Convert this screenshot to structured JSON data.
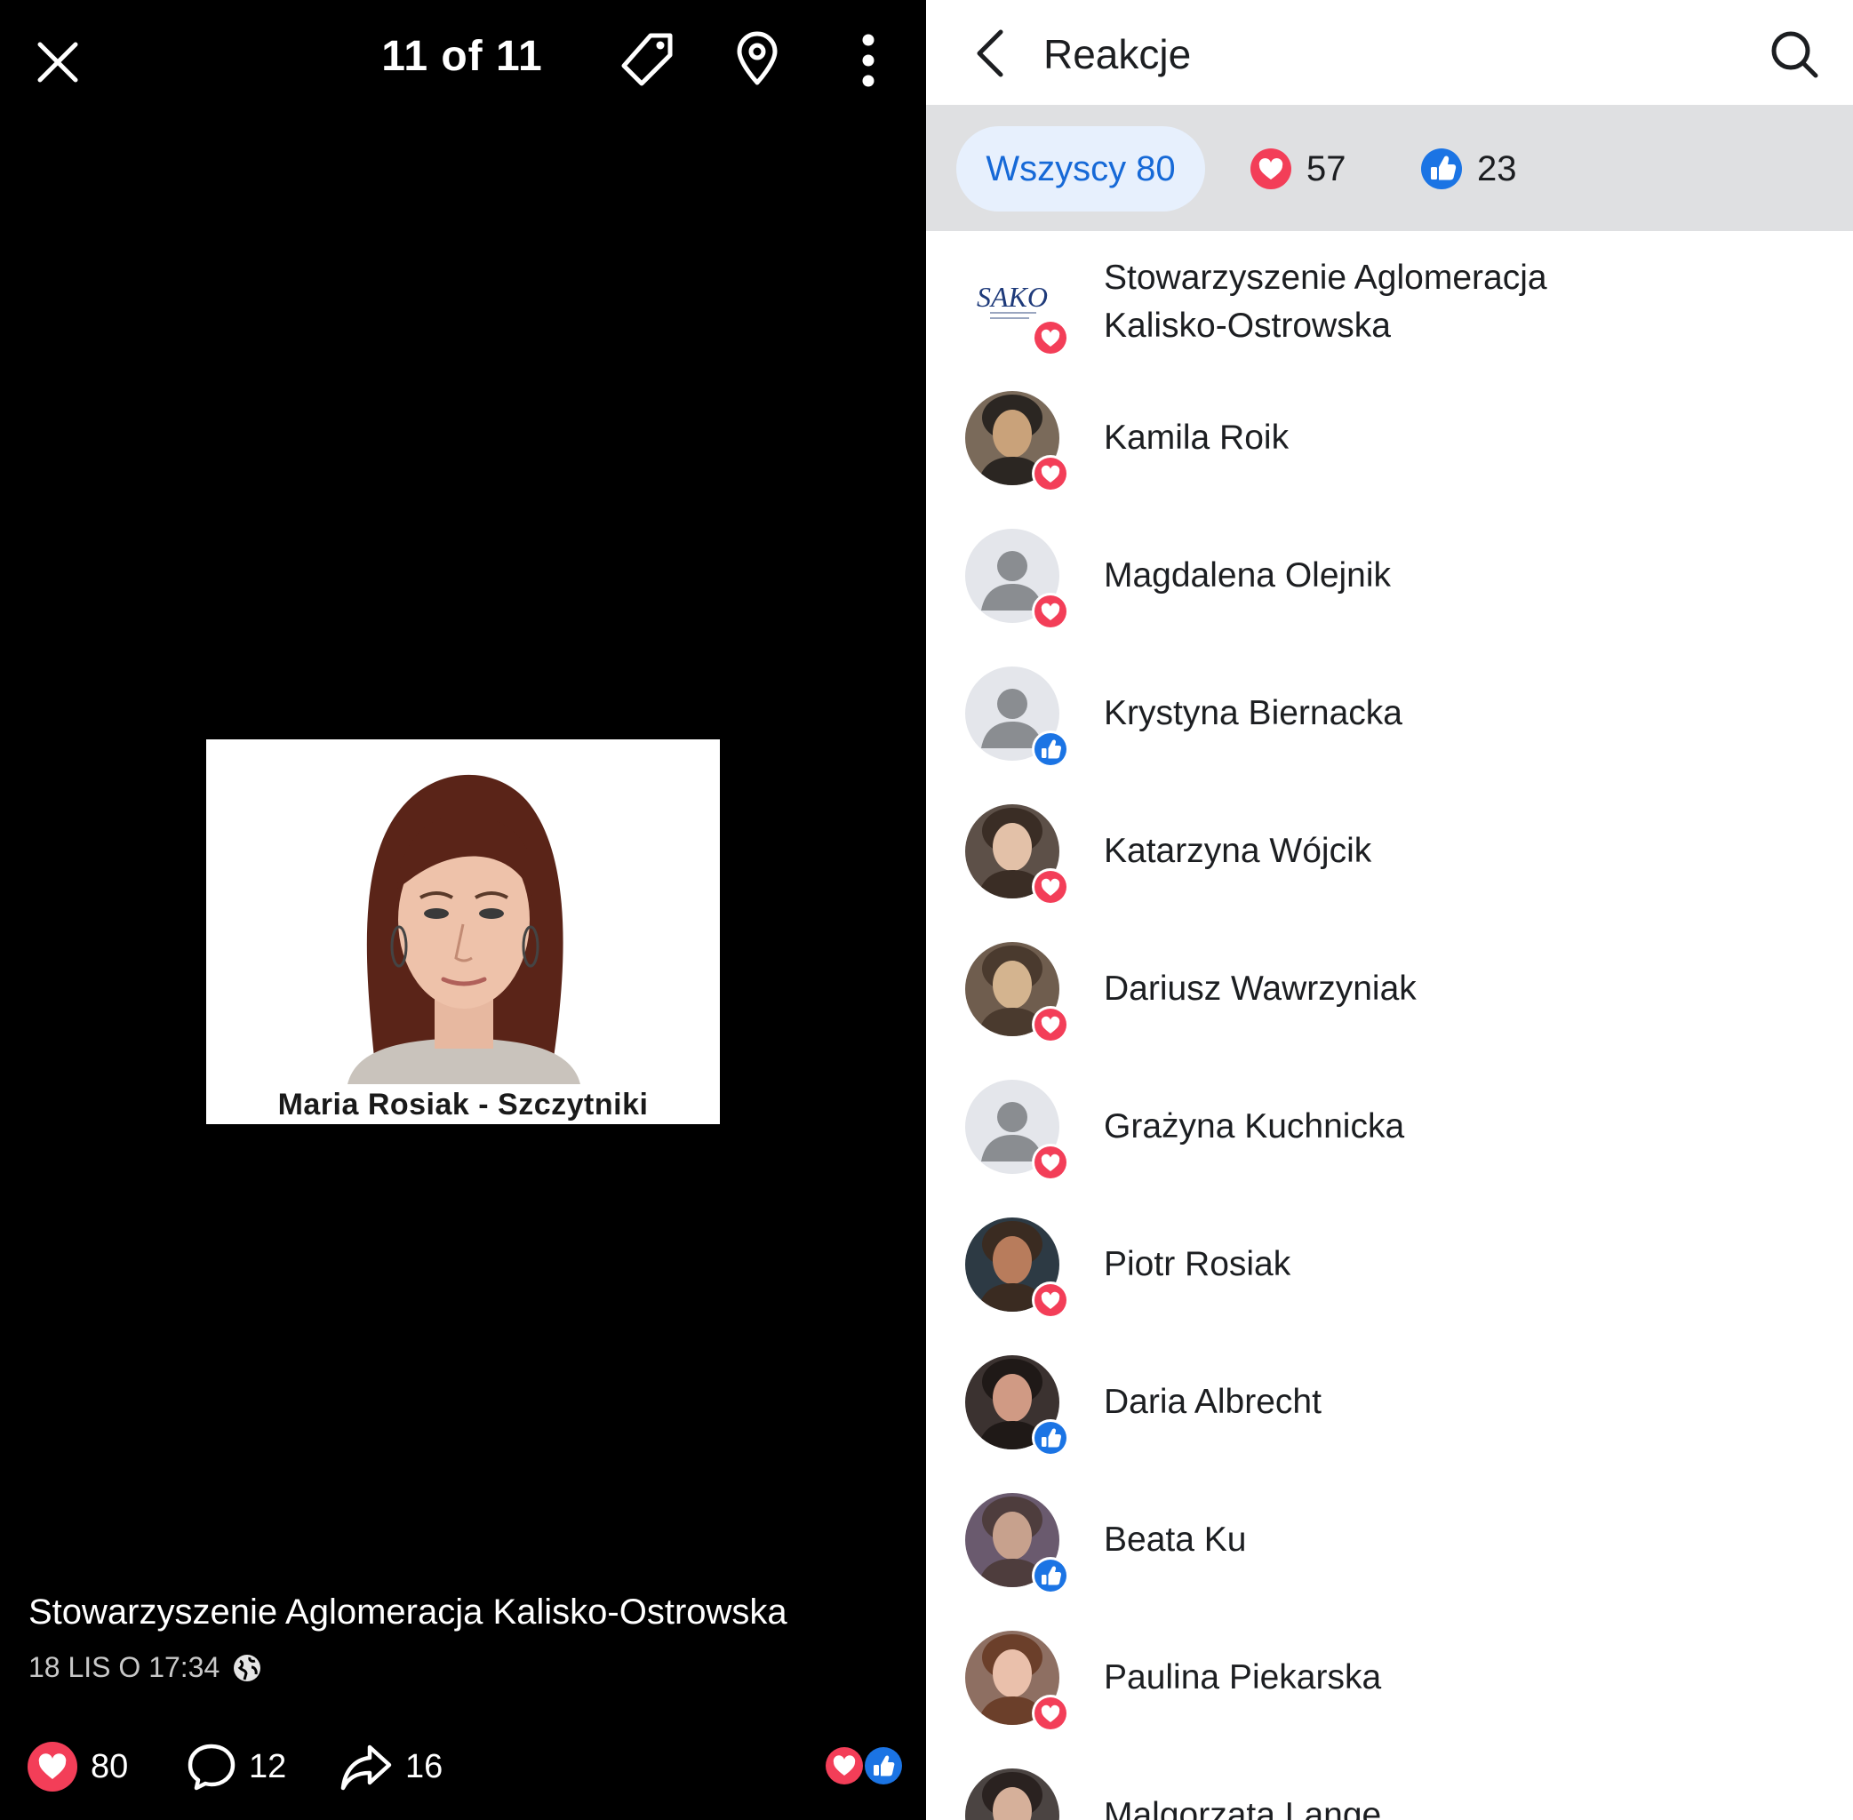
{
  "viewer": {
    "counter": "11 of 11",
    "photo_caption": "Maria Rosiak - Szczytniki",
    "author": "Stowarzyszenie Aglomeracja Kalisko-Ostrowska",
    "date": "18 LIS O 17:34",
    "stats": {
      "reactions": "80",
      "comments": "12",
      "shares": "16"
    },
    "icons": [
      "close-icon",
      "tag-icon",
      "location-pin-icon",
      "more-vertical-icon",
      "globe-icon",
      "heart-icon",
      "comment-icon",
      "share-icon",
      "like-icon"
    ]
  },
  "panel": {
    "title": "Reakcje",
    "tabs": {
      "all": "Wszyscy 80",
      "love_count": "57",
      "like_count": "23"
    },
    "people": [
      {
        "name": "Stowarzyszenie Aglomeracja Kalisko-Ostrowska",
        "reaction": "love",
        "avatar": "logo",
        "logo_text": "SAKO"
      },
      {
        "name": "Kamila Roik",
        "reaction": "love",
        "avatar": "photo"
      },
      {
        "name": "Magdalena Olejnik",
        "reaction": "love",
        "avatar": "default"
      },
      {
        "name": "Krystyna Biernacka",
        "reaction": "like",
        "avatar": "default"
      },
      {
        "name": "Katarzyna Wójcik",
        "reaction": "love",
        "avatar": "photo"
      },
      {
        "name": "Dariusz Wawrzyniak",
        "reaction": "love",
        "avatar": "photo"
      },
      {
        "name": "Grażyna Kuchnicka",
        "reaction": "love",
        "avatar": "default"
      },
      {
        "name": "Piotr Rosiak",
        "reaction": "love",
        "avatar": "photo"
      },
      {
        "name": "Daria Albrecht",
        "reaction": "like",
        "avatar": "photo"
      },
      {
        "name": "Beata Ku",
        "reaction": "like",
        "avatar": "photo"
      },
      {
        "name": "Paulina Piekarska",
        "reaction": "love",
        "avatar": "photo"
      },
      {
        "name": "Malgorzata Lange",
        "reaction": "love",
        "avatar": "photo"
      }
    ]
  },
  "colors": {
    "love": "#f33e58",
    "like": "#1b74e4",
    "tab_active_bg": "#e7f0fd",
    "tab_active_text": "#1669d7",
    "tabs_bar": "#dfe0e2"
  }
}
